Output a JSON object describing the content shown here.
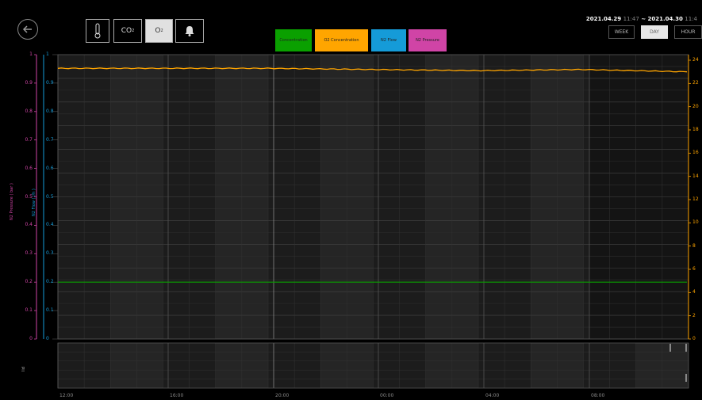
{
  "toolbar": {
    "co2_label": "CO",
    "co2_sub": "2",
    "o2_label": "O",
    "o2_sub": "2"
  },
  "legend": [
    {
      "label": "Concentration",
      "color": "#0aa000"
    },
    {
      "label": "O2 Concentration",
      "color": "#ffa500"
    },
    {
      "label": "N2 Flow",
      "color": "#159bd8"
    },
    {
      "label": "N2 Pressure",
      "color": "#d044a6"
    }
  ],
  "date_range": {
    "start_date": "2021.04.29",
    "start_time": "11:47",
    "separator": "~",
    "end_date": "2021.04.30",
    "end_time": "11:4"
  },
  "range_tabs": [
    "WEEK",
    "DAY",
    "HOUR"
  ],
  "selected_range": "DAY",
  "axes": {
    "pressure_title": "N2 Pressure ( bar )",
    "flow_title": "N2 Flow ( l/h )",
    "lower_title": "lid",
    "pressure_ticks": [
      "1",
      "0.9",
      "0.8",
      "0.7",
      "0.6",
      "0.5",
      "0.4",
      "0.3",
      "0.2",
      "0.1",
      "0"
    ],
    "flow_ticks": [
      "1",
      "0.9",
      "0.8",
      "0.7",
      "0.6",
      "0.5",
      "0.4",
      "0.3",
      "0.2",
      "0.1",
      "0"
    ],
    "right_ticks": [
      "24",
      "22",
      "20",
      "18",
      "16",
      "14",
      "12",
      "10",
      "8",
      "6",
      "4",
      "2",
      "0"
    ],
    "x_ticks": [
      "12:00",
      "16:00",
      "20:00",
      "00:00",
      "04:00",
      "08:00"
    ]
  },
  "colors": {
    "pressure": "#d044a6",
    "flow": "#159bd8",
    "o2": "#ffa500",
    "co2": "#0aa000",
    "accent_bg": "#000000"
  },
  "chart_data": {
    "type": "line",
    "x": [
      "12:00",
      "16:00",
      "20:00",
      "00:00",
      "04:00",
      "08:00",
      "11:47"
    ],
    "series": [
      {
        "name": "O2 Concentration",
        "values": [
          23.3,
          23.3,
          23.3,
          23.2,
          23.1,
          23.2,
          23.0
        ]
      },
      {
        "name": "Concentration",
        "values": [
          0.2,
          0.2,
          0.2,
          0.2,
          0.2,
          0.2,
          0.2
        ]
      }
    ],
    "ylim_right": [
      0,
      24
    ],
    "ylim_left": [
      0,
      1
    ],
    "grid": true
  }
}
